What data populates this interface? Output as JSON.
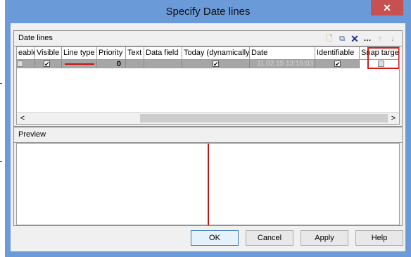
{
  "window": {
    "title": "Specify Date lines",
    "close_glyph": "✕"
  },
  "date_lines": {
    "title": "Date lines",
    "toolbar": [
      {
        "name": "new-icon",
        "glyph": "🗋"
      },
      {
        "name": "copy-icon",
        "glyph": "⧉"
      },
      {
        "name": "delete-icon",
        "glyph": "✕"
      },
      {
        "name": "more-icon",
        "glyph": "…"
      },
      {
        "name": "move-up-icon",
        "glyph": "↑"
      },
      {
        "name": "move-down-icon",
        "glyph": "↓"
      }
    ],
    "columns": [
      "eable",
      "Visible",
      "Line type",
      "Priority",
      "Text",
      "Data field",
      "Today (dynamically)",
      "Date",
      "Identifiable",
      "Snap target"
    ],
    "row": {
      "editable": false,
      "visible": true,
      "line_color": "#cc1111",
      "priority": "0",
      "text": "",
      "data_field": "",
      "today_dynamically": true,
      "date": "11.02.15 13:15:03",
      "identifiable": true,
      "snap_target": false
    },
    "scroll_left": "<",
    "scroll_right": ">"
  },
  "preview": {
    "title": "Preview",
    "line_color": "#cc1111"
  },
  "buttons": {
    "ok": "OK",
    "cancel": "Cancel",
    "apply": "Apply",
    "help": "Help"
  },
  "colors": {
    "titlebar": "#6a9ad8",
    "close": "#c75050",
    "highlight": "#d01c1c"
  }
}
